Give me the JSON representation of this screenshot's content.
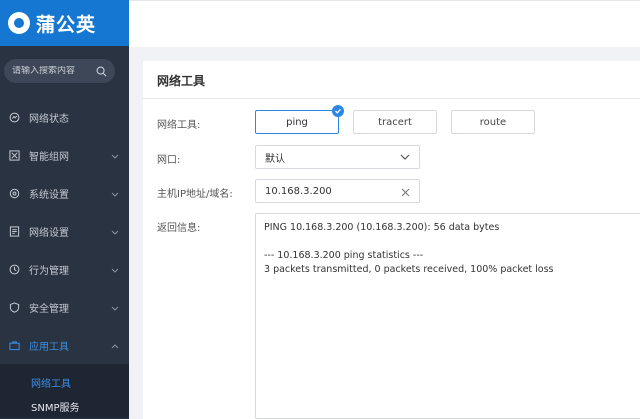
{
  "app": {
    "logo_text": "蒲公英"
  },
  "sidebar": {
    "search_placeholder": "请输入搜索内容",
    "items": [
      {
        "label": "网络状态",
        "icon": "network-status-icon",
        "has_chevron": false
      },
      {
        "label": "智能组网",
        "icon": "smart-network-icon",
        "has_chevron": true
      },
      {
        "label": "系统设置",
        "icon": "gear-icon",
        "has_chevron": true
      },
      {
        "label": "网络设置",
        "icon": "network-settings-icon",
        "has_chevron": true
      },
      {
        "label": "行为管理",
        "icon": "behavior-icon",
        "has_chevron": true
      },
      {
        "label": "安全管理",
        "icon": "shield-icon",
        "has_chevron": true
      },
      {
        "label": "应用工具",
        "icon": "toolbox-icon",
        "has_chevron": true,
        "active": true
      }
    ],
    "subitems": [
      {
        "label": "网络工具",
        "active": true
      },
      {
        "label": "SNMP服务",
        "active": false
      }
    ]
  },
  "panel": {
    "title": "网络工具",
    "tool_label": "网络工具:",
    "tools": [
      "ping",
      "tracert",
      "route"
    ],
    "selected_tool": "ping",
    "port_label": "网口:",
    "port_value": "默认",
    "host_label": "主机IP地址/域名:",
    "host_value": "10.168.3.200",
    "result_label": "返回信息:",
    "result_lines": [
      "PING 10.168.3.200 (10.168.3.200): 56 data bytes",
      "",
      "--- 10.168.3.200 ping statistics ---",
      "3 packets transmitted, 0 packets received, 100% packet loss"
    ]
  },
  "colors": {
    "sidebar_bg": "#2a3342",
    "logo_bg": "#1677d2",
    "accent": "#2b85e4"
  }
}
